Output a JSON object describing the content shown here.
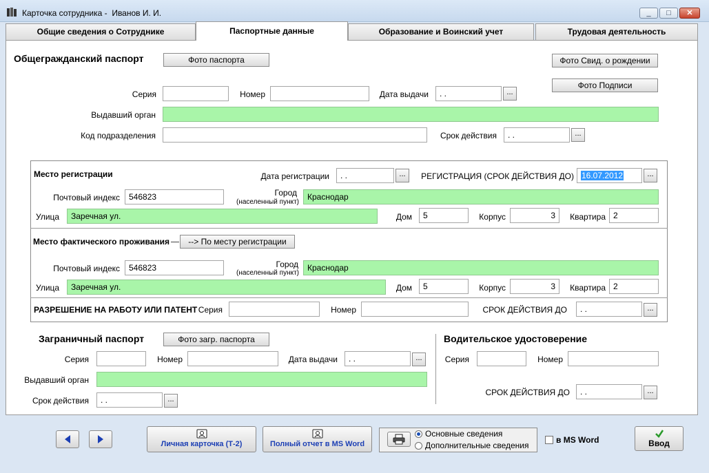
{
  "window": {
    "title": "Карточка сотрудника -  Иванов И. И.",
    "minimize": "▭",
    "maximize": "□",
    "close": "✕"
  },
  "tabs": [
    {
      "label": "Общие сведения о Сотруднике",
      "active": false
    },
    {
      "label": "Паспортные данные",
      "active": true
    },
    {
      "label": "Образование и Воинский учет",
      "active": false
    },
    {
      "label": "Трудовая деятельность",
      "active": false
    }
  ],
  "civil_passport": {
    "heading": "Общегражданский паспорт",
    "photo_button": "Фото паспорта",
    "birth_cert_button": "Фото Свид. о рождении",
    "signature_button": "Фото Подписи",
    "series_label": "Серия",
    "series_value": "",
    "number_label": "Номер",
    "number_value": "",
    "issue_date_label": "Дата выдачи",
    "issue_date_value": " .  .",
    "issuer_label": "Выдавший орган",
    "issuer_value": "",
    "division_code_label": "Код подразделения",
    "division_code_value": "",
    "validity_label": "Срок действия",
    "validity_value": " .  ."
  },
  "registration": {
    "heading": "Место регистрации",
    "reg_date_label": "Дата регистрации",
    "reg_date_value": " .  .",
    "reg_until_label": "РЕГИСТРАЦИЯ (СРОК ДЕЙСТВИЯ ДО)",
    "reg_until_value": "16.07.2012",
    "postal_label": "Почтовый индекс",
    "postal_value": "546823",
    "city_label": "Город",
    "city_sub_label": "(населенный пункт)",
    "city_value": "Краснодар",
    "street_label": "Улица",
    "street_value": "Заречная ул.",
    "house_label": "Дом",
    "house_value": "5",
    "building_label": "Корпус",
    "building_value": "3",
    "apartment_label": "Квартира",
    "apartment_value": "2"
  },
  "residence": {
    "heading": "Место фактического проживания",
    "copy_button": "--> По месту регистрации",
    "postal_label": "Почтовый индекс",
    "postal_value": "546823",
    "city_label": "Город",
    "city_sub_label": "(населенный пункт)",
    "city_value": "Краснодар",
    "street_label": "Улица",
    "street_value": "Заречная ул.",
    "house_label": "Дом",
    "house_value": "5",
    "building_label": "Корпус",
    "building_value": "3",
    "apartment_label": "Квартира",
    "apartment_value": "2"
  },
  "work_permit": {
    "heading": "РАЗРЕШЕНИЕ НА РАБОТУ ИЛИ ПАТЕНТ",
    "series_label": "Серия",
    "series_value": "",
    "number_label": "Номер",
    "number_value": "",
    "valid_until_label": "СРОК ДЕЙСТВИЯ ДО",
    "valid_until_value": " .  ."
  },
  "foreign_passport": {
    "heading": "Заграничный паспорт",
    "photo_button": "Фото загр. паспорта",
    "series_label": "Серия",
    "series_value": "",
    "number_label": "Номер",
    "number_value": "",
    "issue_date_label": "Дата выдачи",
    "issue_date_value": " .  .",
    "issuer_label": "Выдавший орган",
    "issuer_value": "",
    "validity_label": "Срок действия",
    "validity_value": " .  ."
  },
  "driver_license": {
    "heading": "Водительское удостоверение",
    "series_label": "Серия",
    "series_value": "",
    "number_label": "Номер",
    "number_value": "",
    "valid_until_label": "СРОК ДЕЙСТВИЯ ДО",
    "valid_until_value": " .  ."
  },
  "common": {
    "dots": "..."
  },
  "footer": {
    "personal_card_button": "Личная карточка (Т-2)",
    "full_report_button": "Полный отчет в MS Word",
    "print_main_label": "Основные сведения",
    "print_extra_label": "Дополнительные сведения",
    "print_selected": "main",
    "ms_word_label": "в MS Word",
    "ms_word_checked": false,
    "enter_button": "Ввод"
  },
  "colors": {
    "green_field": "#a9f5a9",
    "accent_blue": "#1c3fb4"
  }
}
